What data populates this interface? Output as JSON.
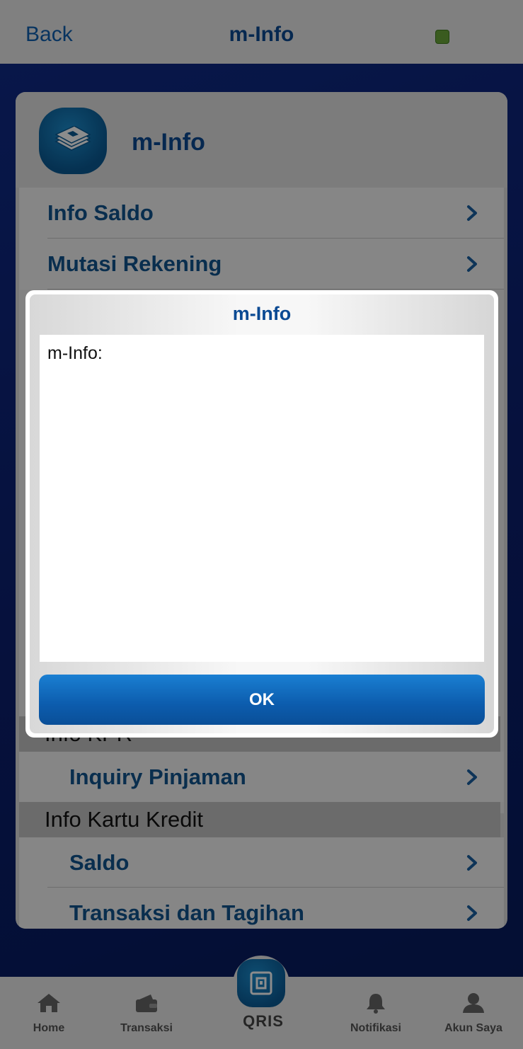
{
  "topbar": {
    "back_label": "Back",
    "title": "m-Info",
    "status_color": "#6aa63a"
  },
  "card": {
    "title": "m-Info",
    "icon": "bills-icon",
    "items": [
      {
        "label": "Info Saldo"
      },
      {
        "label": "Mutasi Rekening"
      }
    ],
    "sections": [
      {
        "label": "Info KPR",
        "items": [
          {
            "label": "Inquiry Pinjaman"
          }
        ]
      },
      {
        "label": "Info Kartu Kredit",
        "items": [
          {
            "label": "Saldo"
          },
          {
            "label": "Transaksi dan Tagihan"
          }
        ]
      }
    ]
  },
  "dialog": {
    "title": "m-Info",
    "message": "m-Info:",
    "ok_label": "OK"
  },
  "bottomnav": {
    "items": [
      {
        "label": "Home",
        "icon": "home-icon"
      },
      {
        "label": "Transaksi",
        "icon": "wallet-icon"
      },
      {
        "label": "QRIS",
        "icon": "qris-icon"
      },
      {
        "label": "Notifikasi",
        "icon": "bell-icon"
      },
      {
        "label": "Akun Saya",
        "icon": "user-icon"
      }
    ]
  },
  "colors": {
    "accent": "#0b4a93",
    "link": "#1060b0",
    "background": "#0a1e66"
  }
}
